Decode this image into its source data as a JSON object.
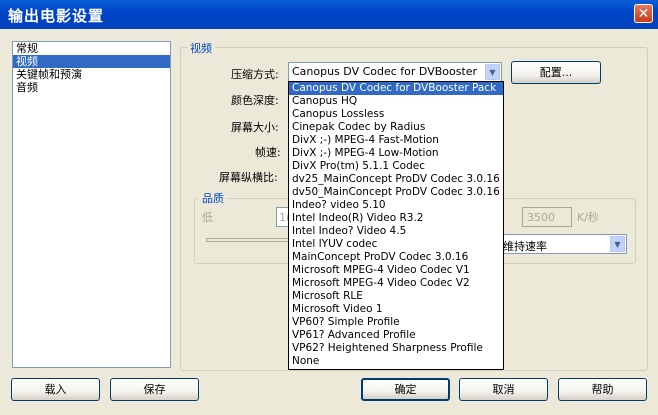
{
  "window": {
    "title": "输出电影设置",
    "close_icon": "close-icon"
  },
  "sidebar": {
    "items": [
      {
        "label": "常规",
        "selected": false
      },
      {
        "label": "视频",
        "selected": true
      },
      {
        "label": "关键帧和预演",
        "selected": false
      },
      {
        "label": "音频",
        "selected": false
      }
    ]
  },
  "video": {
    "group_title": "视频",
    "compression_label": "压缩方式:",
    "compression_value": "Canopus DV Codec for DVBooster Pack",
    "configure_label": "配置...",
    "color_depth_label": "颜色深度:",
    "frame_size_label": "屏幕大小:",
    "frame_rate_label": "帧速:",
    "aspect_label": "屏幕纵横比:",
    "quality_title": "品质",
    "quality_low": "低",
    "quality_partial": "1(",
    "datarate_value": "3500",
    "datarate_unit": "K/秒",
    "rate_select": "维持速率"
  },
  "codec_options": [
    "Canopus DV Codec for DVBooster Pack",
    "Canopus HQ",
    "Canopus Lossless",
    "Cinepak Codec by Radius",
    "DivX ;-) MPEG-4 Fast-Motion",
    "DivX ;-) MPEG-4 Low-Motion",
    "DivX Pro(tm) 5.1.1 Codec",
    "dv25_MainConcept ProDV Codec 3.0.16",
    "dv50_MainConcept ProDV Codec 3.0.16",
    "Indeo? video 5.10",
    "Intel Indeo(R) Video R3.2",
    "Intel Indeo? Video 4.5",
    "Intel IYUV codec",
    "MainConcept ProDV Codec 3.0.16",
    "Microsoft MPEG-4 Video Codec V1",
    "Microsoft MPEG-4 Video Codec V2",
    "Microsoft RLE",
    "Microsoft Video 1",
    "VP60? Simple Profile",
    "VP61? Advanced Profile",
    "VP62? Heightened Sharpness Profile",
    "None"
  ],
  "buttons": {
    "load": "载入",
    "save": "保存",
    "ok": "确定",
    "cancel": "取消",
    "help": "帮助"
  }
}
